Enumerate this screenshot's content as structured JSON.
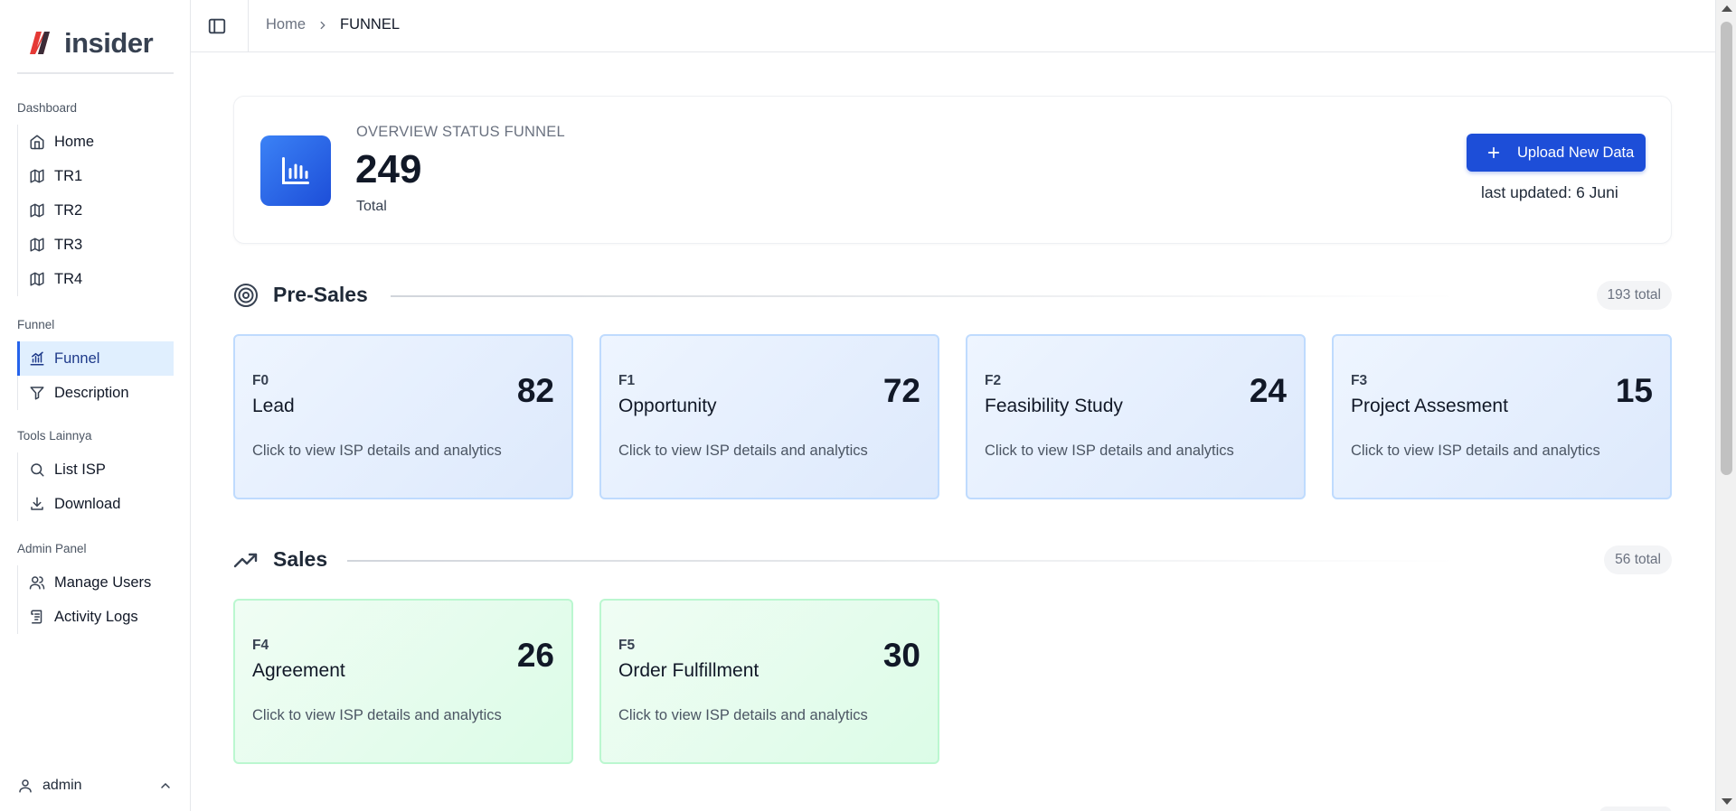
{
  "brand": {
    "name": "insider",
    "logo": "insider-logo-icon"
  },
  "sidebar": {
    "groups": [
      {
        "label": "Dashboard",
        "items": [
          {
            "label": "Home",
            "icon": "home-icon"
          },
          {
            "label": "TR1",
            "icon": "map-icon"
          },
          {
            "label": "TR2",
            "icon": "map-icon"
          },
          {
            "label": "TR3",
            "icon": "map-icon"
          },
          {
            "label": "TR4",
            "icon": "map-icon"
          }
        ]
      },
      {
        "label": "Funnel",
        "items": [
          {
            "label": "Funnel",
            "icon": "chart-icon",
            "active": true
          },
          {
            "label": "Description",
            "icon": "filter-icon"
          }
        ]
      },
      {
        "label": "Tools Lainnya",
        "items": [
          {
            "label": "List ISP",
            "icon": "search-icon"
          },
          {
            "label": "Download",
            "icon": "download-icon"
          }
        ]
      },
      {
        "label": "Admin Panel",
        "items": [
          {
            "label": "Manage Users",
            "icon": "users-icon"
          },
          {
            "label": "Activity Logs",
            "icon": "logs-icon"
          }
        ]
      }
    ],
    "user": {
      "name": "admin",
      "icon": "user-icon"
    }
  },
  "topbar": {
    "breadcrumb": {
      "home": "Home",
      "current": "FUNNEL"
    },
    "toggle_icon": "sidebar-toggle-icon"
  },
  "overview": {
    "label": "OVERVIEW STATUS FUNNEL",
    "total": "249",
    "total_label": "Total",
    "upload_label": "Upload New Data",
    "last_updated": "last updated: 6 Juni"
  },
  "sections": {
    "presales": {
      "title": "Pre-Sales",
      "badge": "193 total",
      "icon": "target-icon"
    },
    "sales": {
      "title": "Sales",
      "badge": "56 total",
      "icon": "trending-up-icon"
    }
  },
  "stages": {
    "presales": [
      {
        "code": "F0",
        "name": "Lead",
        "count": "82",
        "hint": "Click to view ISP details and analytics"
      },
      {
        "code": "F1",
        "name": "Opportunity",
        "count": "72",
        "hint": "Click to view ISP details and analytics"
      },
      {
        "code": "F2",
        "name": "Feasibility Study",
        "count": "24",
        "hint": "Click to view ISP details and analytics"
      },
      {
        "code": "F3",
        "name": "Project Assesment",
        "count": "15",
        "hint": "Click to view ISP details and analytics"
      }
    ],
    "sales": [
      {
        "code": "F4",
        "name": "Agreement",
        "count": "26",
        "hint": "Click to view ISP details and analytics"
      },
      {
        "code": "F5",
        "name": "Order Fulfillment",
        "count": "30",
        "hint": "Click to view ISP details and analytics"
      }
    ]
  },
  "colors": {
    "accent": "#1d4ed8",
    "presales_card": "#e6effd",
    "sales_card": "#e5fbec"
  }
}
